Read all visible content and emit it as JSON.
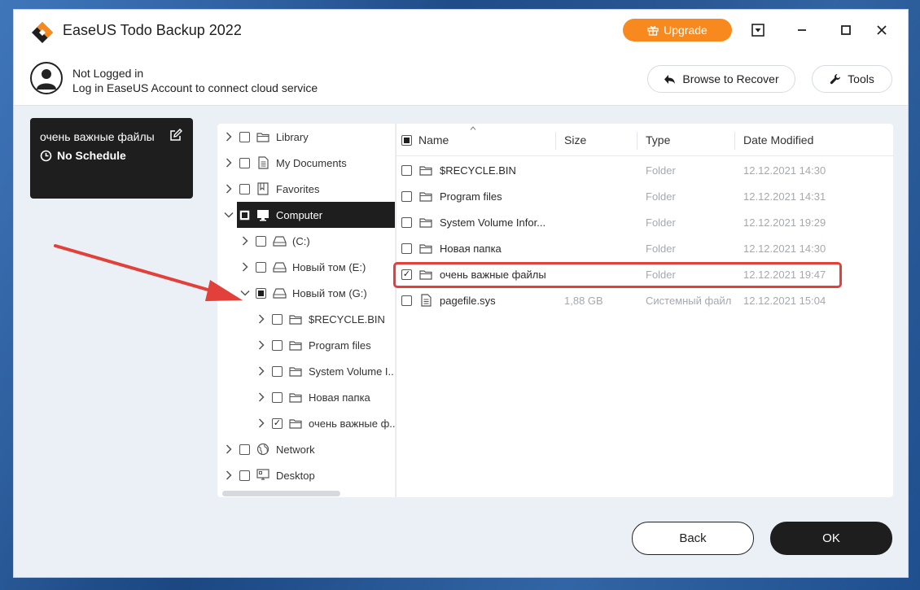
{
  "app": {
    "title": "EaseUS Todo Backup 2022"
  },
  "titlebar": {
    "upgrade_label": "Upgrade"
  },
  "account": {
    "name": "Not Logged in",
    "description": "Log in EaseUS Account to connect cloud service",
    "browse_label": "Browse to Recover",
    "tools_label": "Tools"
  },
  "backup_card": {
    "name": "очень важные файлы",
    "schedule": "No Schedule"
  },
  "tree": [
    {
      "label": "Library",
      "icon": "library-icon",
      "level": 0,
      "expanded": false,
      "check": "none"
    },
    {
      "label": "My Documents",
      "icon": "document-icon",
      "level": 0,
      "expanded": false,
      "check": "none"
    },
    {
      "label": "Favorites",
      "icon": "favorites-icon",
      "level": 0,
      "expanded": false,
      "check": "none"
    },
    {
      "label": "Computer",
      "icon": "monitor-icon",
      "level": 0,
      "expanded": true,
      "check": "partial",
      "selected": true
    },
    {
      "label": "(C:)",
      "icon": "drive-icon",
      "level": 1,
      "expanded": false,
      "check": "none"
    },
    {
      "label": "Новый том (E:)",
      "icon": "drive-icon",
      "level": 1,
      "expanded": false,
      "check": "none"
    },
    {
      "label": "Новый том (G:)",
      "icon": "drive-icon",
      "level": 1,
      "expanded": true,
      "check": "partial"
    },
    {
      "label": "$RECYCLE.BIN",
      "icon": "folder-icon",
      "level": 2,
      "expanded": false,
      "check": "none"
    },
    {
      "label": "Program files",
      "icon": "folder-icon",
      "level": 2,
      "expanded": false,
      "check": "none"
    },
    {
      "label": "System Volume I...",
      "icon": "folder-icon",
      "level": 2,
      "expanded": false,
      "check": "none"
    },
    {
      "label": "Новая папка",
      "icon": "folder-icon",
      "level": 2,
      "expanded": false,
      "check": "none"
    },
    {
      "label": "очень важные ф...",
      "icon": "folder-icon",
      "level": 2,
      "expanded": false,
      "check": "checked"
    },
    {
      "label": "Network",
      "icon": "network-icon",
      "level": 0,
      "expanded": false,
      "check": "none"
    },
    {
      "label": "Desktop",
      "icon": "desktop-icon",
      "level": 0,
      "expanded": false,
      "check": "none"
    }
  ],
  "file_list": {
    "columns": {
      "name": "Name",
      "size": "Size",
      "type": "Type",
      "date": "Date Modified"
    },
    "rows": [
      {
        "name": "$RECYCLE.BIN",
        "size": "",
        "type": "Folder",
        "date": "12.12.2021 14:30",
        "icon": "folder-icon",
        "checked": false
      },
      {
        "name": "Program files",
        "size": "",
        "type": "Folder",
        "date": "12.12.2021 14:31",
        "icon": "folder-icon",
        "checked": false
      },
      {
        "name": "System Volume Infor...",
        "size": "",
        "type": "Folder",
        "date": "12.12.2021 19:29",
        "icon": "folder-icon",
        "checked": false
      },
      {
        "name": "Новая папка",
        "size": "",
        "type": "Folder",
        "date": "12.12.2021 14:30",
        "icon": "folder-icon",
        "checked": false
      },
      {
        "name": "очень важные файлы",
        "size": "",
        "type": "Folder",
        "date": "12.12.2021 19:47",
        "icon": "folder-icon",
        "checked": true
      },
      {
        "name": "pagefile.sys",
        "size": "1,88 GB",
        "type": "Системный файл",
        "date": "12.12.2021 15:04",
        "icon": "file-icon",
        "checked": false
      }
    ]
  },
  "footer": {
    "back_label": "Back",
    "ok_label": "OK"
  },
  "colors": {
    "accent": "#f7891e",
    "dark": "#1e1e1e",
    "highlight": "#e2403a",
    "window_bg": "#ebf0f6"
  }
}
